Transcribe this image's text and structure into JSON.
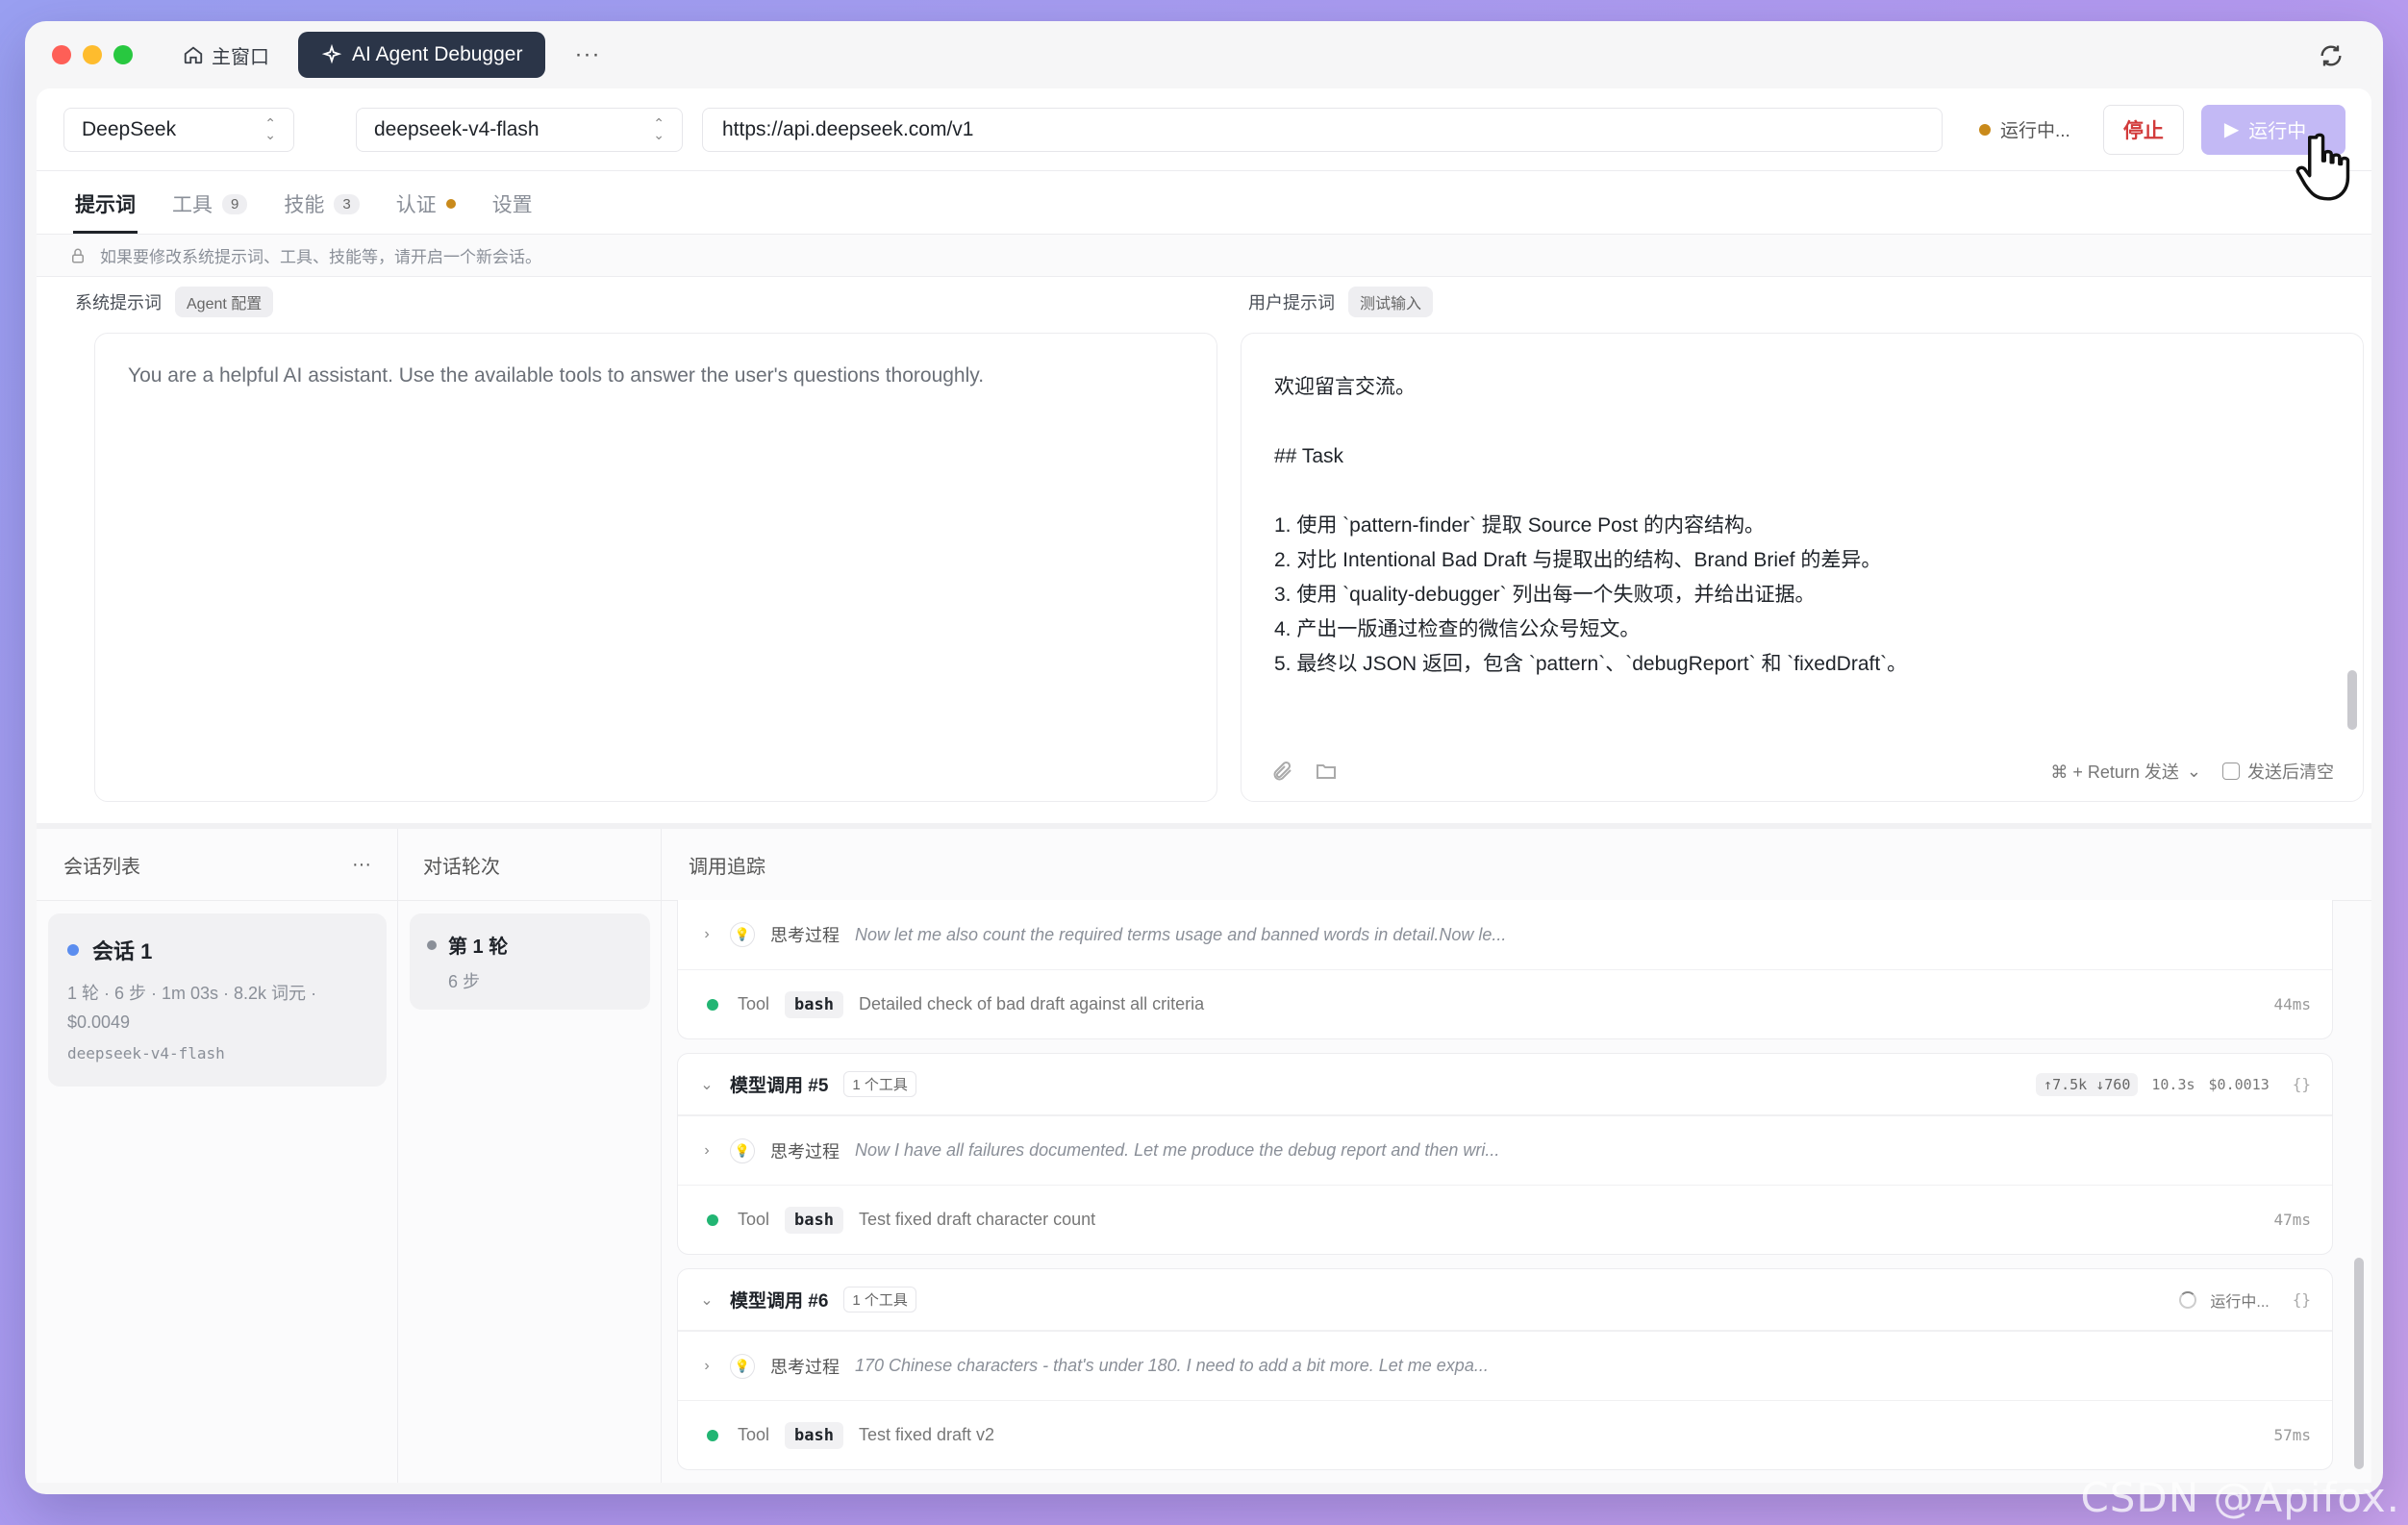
{
  "titlebar": {
    "home_tab": "主窗口",
    "active_tab": "AI Agent Debugger",
    "more": "···"
  },
  "toolbar": {
    "provider": "DeepSeek",
    "model": "deepseek-v4-flash",
    "base_url": "https://api.deepseek.com/v1",
    "status": "运行中...",
    "stop_label": "停止",
    "run_label": "运行中..."
  },
  "tabs": [
    {
      "label": "提示词",
      "count": null
    },
    {
      "label": "工具",
      "count": "9"
    },
    {
      "label": "技能",
      "count": "3"
    },
    {
      "label": "认证",
      "count": null
    },
    {
      "label": "设置",
      "count": null
    }
  ],
  "notice": "如果要修改系统提示词、工具、技能等，请开启一个新会话。",
  "system_prompt": {
    "label": "系统提示词",
    "chip": "Agent 配置",
    "text": "You are a helpful AI assistant. Use the available tools to answer the user's questions thoroughly."
  },
  "user_prompt": {
    "label": "用户提示词",
    "chip": "测试输入",
    "lines": [
      "欢迎留言交流。",
      "",
      "## Task",
      "",
      "1. 使用 `pattern-finder` 提取 Source Post 的内容结构。",
      "2. 对比 Intentional Bad Draft 与提取出的结构、Brand Brief 的差异。",
      "3. 使用 `quality-debugger` 列出每一个失败项，并给出证据。",
      "4. 产出一版通过检查的微信公众号短文。",
      "5. 最终以 JSON 返回，包含 `pattern`、`debugReport` 和 `fixedDraft`。"
    ],
    "send_hint": "⌘ + Return 发送",
    "clear_after_send": "发送后清空"
  },
  "sessions": {
    "header": "会话列表",
    "more": "···",
    "items": [
      {
        "title": "会话 1",
        "meta": "1 轮 · 6 步 · 1m 03s · 8.2k 词元 · $0.0049",
        "model": "deepseek-v4-flash"
      }
    ]
  },
  "rounds": {
    "header": "对话轮次",
    "items": [
      {
        "title": "第 1 轮",
        "sub": "6 步"
      }
    ]
  },
  "trace": {
    "header": "调用追踪",
    "groups": [
      {
        "title": null,
        "rows": [
          {
            "kind": "think",
            "label": "思考过程",
            "text": "Now let me also count the required terms usage and banned words in detail.Now le..."
          },
          {
            "kind": "tool",
            "label": "Tool",
            "tool": "bash",
            "text": "Detailed check of bad draft against all criteria",
            "duration": "44ms"
          }
        ]
      },
      {
        "title": "模型调用 #5",
        "badge": "1 个工具",
        "tokens_in": "↑7.5k",
        "tokens_out": "↓760",
        "time": "10.3s",
        "cost": "$0.0013",
        "rows": [
          {
            "kind": "think",
            "label": "思考过程",
            "text": "Now I have all failures documented. Let me produce the debug report and then wri..."
          },
          {
            "kind": "tool",
            "label": "Tool",
            "tool": "bash",
            "text": "Test fixed draft character count",
            "duration": "47ms"
          }
        ]
      },
      {
        "title": "模型调用 #6",
        "badge": "1 个工具",
        "status": "运行中...",
        "rows": [
          {
            "kind": "think",
            "label": "思考过程",
            "text": "170 Chinese characters - that's under 180. I need to add a bit more. Let me expa..."
          },
          {
            "kind": "tool",
            "label": "Tool",
            "tool": "bash",
            "text": "Test fixed draft v2",
            "duration": "57ms"
          }
        ]
      }
    ]
  },
  "braces": "{}",
  "watermark": "CSDN @Apifox."
}
